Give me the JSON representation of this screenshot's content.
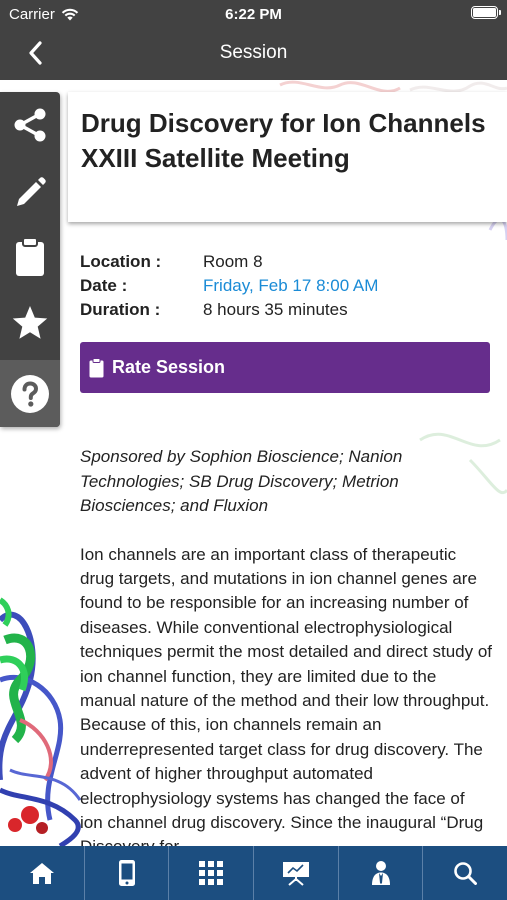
{
  "status_bar": {
    "carrier": "Carrier",
    "time": "6:22 PM"
  },
  "nav": {
    "title": "Session",
    "back_icon": "chevron-left-icon"
  },
  "rail": {
    "items": [
      {
        "icon": "share-icon"
      },
      {
        "icon": "pencil-icon"
      },
      {
        "icon": "clipboard-icon"
      },
      {
        "icon": "star-icon"
      },
      {
        "icon": "help-icon"
      }
    ]
  },
  "session": {
    "title": "Drug Discovery for Ion Channels XXIII Satellite Meeting",
    "location_label": "Location :",
    "location": "Room 8",
    "date_label": "Date :",
    "date": "Friday, Feb 17 8:00 AM",
    "duration_label": "Duration :",
    "duration": "8 hours 35 minutes",
    "rate_label": "Rate Session",
    "sponsors": "Sponsored by Sophion Bioscience; Nanion Technologies; SB Drug Discovery; Metrion Biosciences; and Fluxion",
    "description": "Ion channels are an important class of therapeutic drug targets, and mutations in ion channel genes are found to be responsible for an increasing number of diseases. While conventional electrophysiological techniques permit the most detailed and direct study of ion channel function, they are limited due to the manual nature of the method and their low throughput. Because of this, ion channels remain an underrepresented target class for drug discovery. The advent of higher throughput automated electrophysiology systems has changed the face of ion channel drug discovery. Since the inaugural “Drug Discovery for"
  },
  "colors": {
    "header": "#424242",
    "accent": "#662d8c",
    "link": "#1a8bd6",
    "tabbar": "#1c4e80"
  },
  "tabbar": {
    "tabs": [
      {
        "icon": "home-icon"
      },
      {
        "icon": "mobile-icon"
      },
      {
        "icon": "grid-icon"
      },
      {
        "icon": "presentation-icon"
      },
      {
        "icon": "people-icon"
      },
      {
        "icon": "search-icon"
      }
    ]
  }
}
